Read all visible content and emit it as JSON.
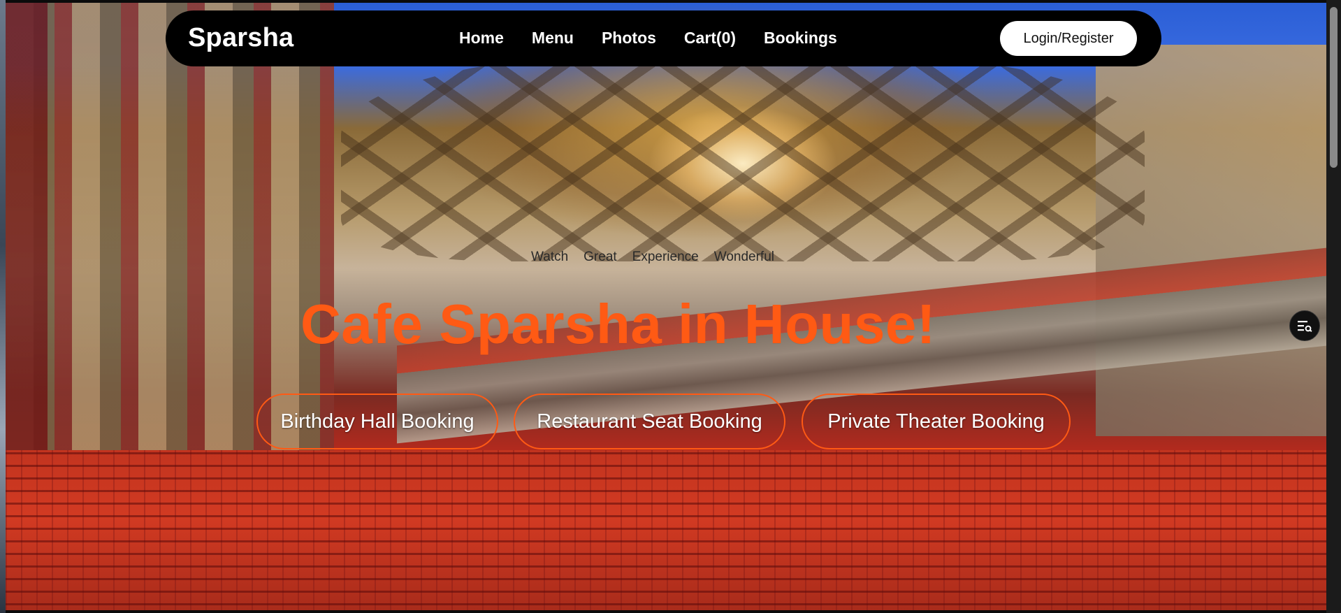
{
  "navbar": {
    "brand": "Sparsha",
    "links": [
      "Home",
      "Menu",
      "Photos",
      "Cart(0)",
      "Bookings"
    ],
    "login_label": "Login/Register"
  },
  "hero": {
    "tagline_words": [
      "Watch",
      "Great",
      "Experience",
      "Wonderful"
    ],
    "headline": "Cafe Sparsha in House!",
    "booking_buttons": [
      "Birthday Hall Booking",
      "Restaurant Seat Booking",
      "Private Theater Booking"
    ],
    "background_image": "theater-interior-photo"
  },
  "icons": {
    "filter_fab": "filter-list-icon"
  },
  "colors": {
    "accent": "#ff5a14",
    "navbar_bg": "#000000",
    "login_bg": "#ffffff"
  }
}
